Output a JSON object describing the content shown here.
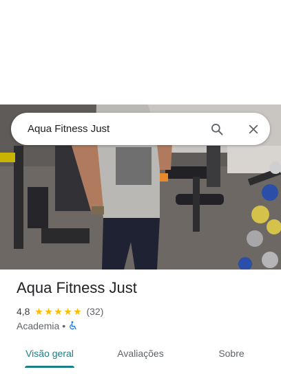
{
  "search": {
    "query": "Aqua Fitness Just",
    "search_icon": "search-icon",
    "close_icon": "close-icon"
  },
  "place": {
    "name": "Aqua Fitness Just",
    "rating": "4,8",
    "stars": 5,
    "review_count": "(32)",
    "category": "Academia",
    "separator": "•",
    "accessibility_icon": "wheelchair-icon"
  },
  "tabs": [
    {
      "label": "Visão geral",
      "active": true
    },
    {
      "label": "Avaliações",
      "active": false
    },
    {
      "label": "Sobre",
      "active": false
    }
  ],
  "colors": {
    "accent": "#1a7e86",
    "star": "#fbbc04",
    "accessibility_icon": "#1a73e8"
  }
}
